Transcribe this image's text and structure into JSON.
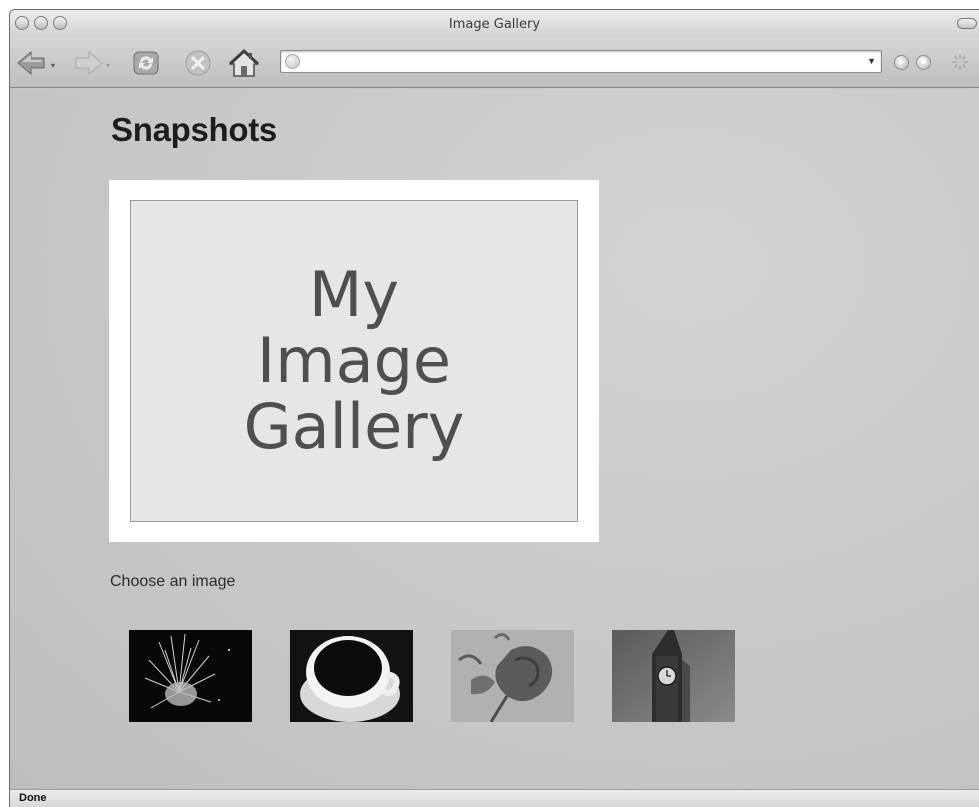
{
  "window": {
    "title": "Image Gallery"
  },
  "toolbar": {
    "icons": [
      "back-arrow-icon",
      "forward-arrow-icon",
      "reload-icon",
      "stop-icon",
      "home-icon"
    ],
    "address_value": ""
  },
  "page": {
    "heading": "Snapshots",
    "placeholder_lines": [
      "My",
      "Image",
      "Gallery"
    ],
    "choose_label": "Choose an image",
    "thumbnails": [
      {
        "icon": "fireworks-image"
      },
      {
        "icon": "coffee-cup-image"
      },
      {
        "icon": "rose-image"
      },
      {
        "icon": "big-ben-image"
      }
    ]
  },
  "status": {
    "text": "Done"
  }
}
